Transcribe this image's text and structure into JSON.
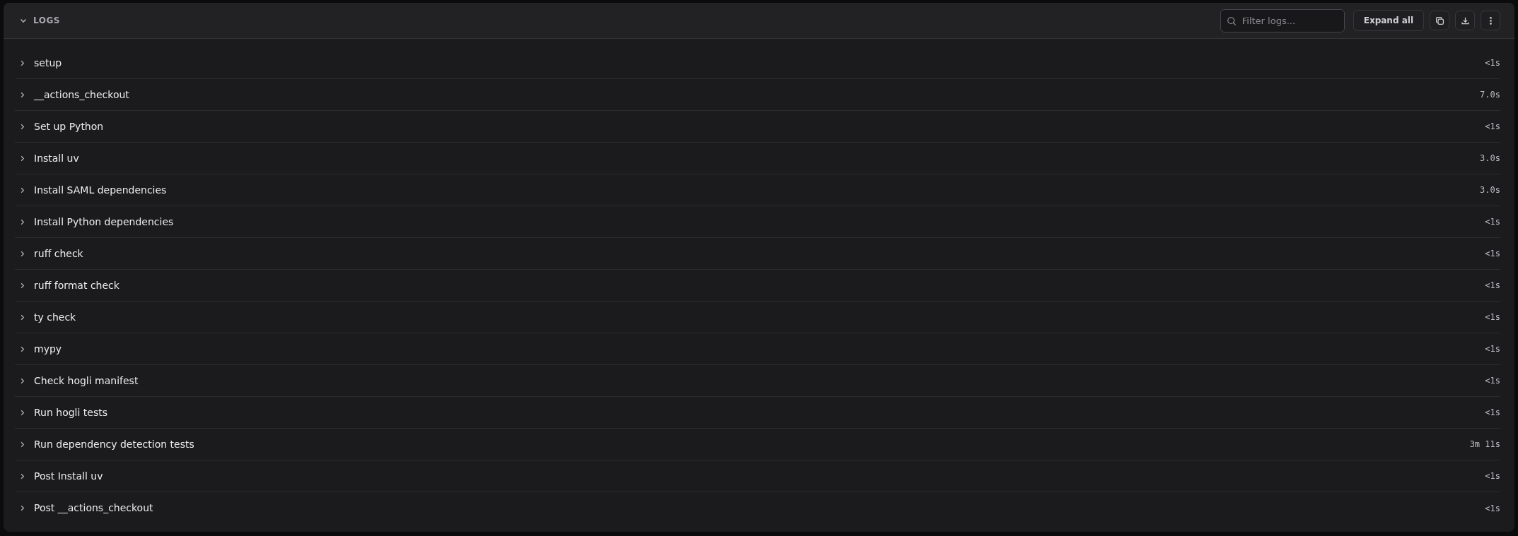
{
  "panel": {
    "title": "LOGS",
    "expanded": true
  },
  "filter": {
    "placeholder": "Filter logs..."
  },
  "toolbar": {
    "expand_button": "Expand all",
    "icon_buttons": [
      {
        "kind": "copy"
      },
      {
        "kind": "download"
      },
      {
        "kind": "more"
      }
    ]
  },
  "steps": [
    {
      "name": "setup",
      "duration": "<1s",
      "expanded": false
    },
    {
      "name": "__actions_checkout",
      "duration": "7.0s",
      "expanded": false
    },
    {
      "name": "Set up Python",
      "duration": "<1s",
      "expanded": false
    },
    {
      "name": "Install uv",
      "duration": "3.0s",
      "expanded": false
    },
    {
      "name": "Install SAML dependencies",
      "duration": "3.0s",
      "expanded": false
    },
    {
      "name": "Install Python dependencies",
      "duration": "<1s",
      "expanded": false
    },
    {
      "name": "ruff check",
      "duration": "<1s",
      "expanded": false
    },
    {
      "name": "ruff format check",
      "duration": "<1s",
      "expanded": false
    },
    {
      "name": "ty check",
      "duration": "<1s",
      "expanded": false
    },
    {
      "name": "mypy",
      "duration": "<1s",
      "expanded": false
    },
    {
      "name": "Check hogli manifest",
      "duration": "<1s",
      "expanded": false
    },
    {
      "name": "Run hogli tests",
      "duration": "<1s",
      "expanded": false
    },
    {
      "name": "Run dependency detection tests",
      "duration": "3m 11s",
      "expanded": false
    },
    {
      "name": "Post Install uv",
      "duration": "<1s",
      "expanded": false
    },
    {
      "name": "Post __actions_checkout",
      "duration": "<1s",
      "expanded": false
    }
  ]
}
